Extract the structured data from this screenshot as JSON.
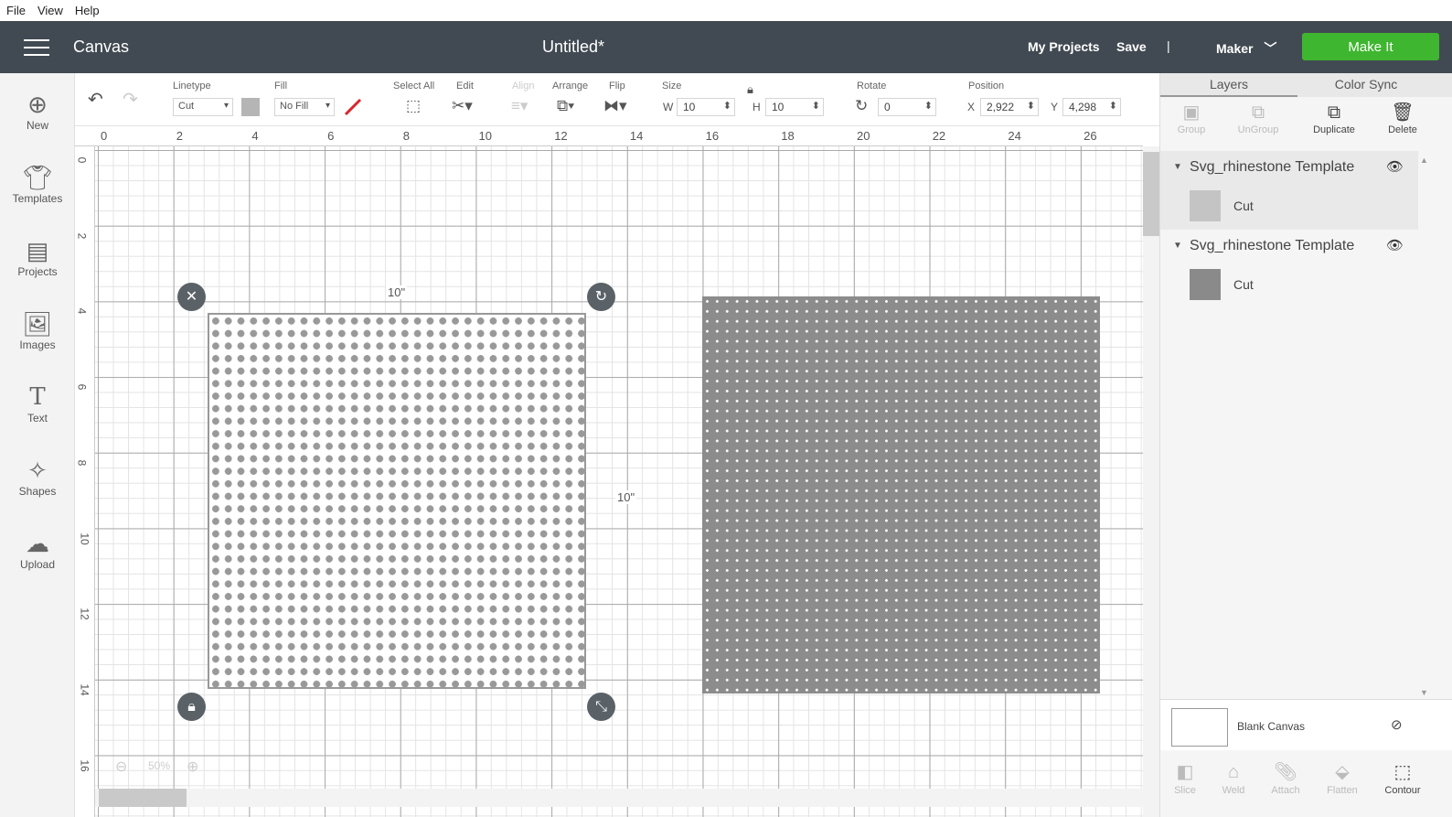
{
  "menu": [
    "File",
    "View",
    "Help"
  ],
  "header": {
    "app_title": "Canvas",
    "doc_title": "Untitled*",
    "my_projects": "My Projects",
    "save": "Save",
    "separator": "|",
    "machine": "Maker",
    "make_it": "Make It"
  },
  "toolbar": {
    "linetype_label": "Linetype",
    "linetype_value": "Cut",
    "fill_label": "Fill",
    "fill_value": "No Fill",
    "select_all_label": "Select All",
    "edit_label": "Edit",
    "align_label": "Align",
    "arrange_label": "Arrange",
    "flip_label": "Flip",
    "size_label": "Size",
    "w_label": "W",
    "w_value": "10",
    "h_label": "H",
    "h_value": "10",
    "rotate_label": "Rotate",
    "rotate_value": "0",
    "position_label": "Position",
    "x_label": "X",
    "x_value": "2,922",
    "y_label": "Y",
    "y_value": "4,298"
  },
  "sidebar": [
    {
      "label": "New",
      "icon": "plus-circle-icon"
    },
    {
      "label": "Templates",
      "icon": "tshirt-icon"
    },
    {
      "label": "Projects",
      "icon": "projects-icon"
    },
    {
      "label": "Images",
      "icon": "image-icon"
    },
    {
      "label": "Text",
      "icon": "text-icon"
    },
    {
      "label": "Shapes",
      "icon": "shapes-icon"
    },
    {
      "label": "Upload",
      "icon": "upload-cloud-icon"
    }
  ],
  "ruler": {
    "top": [
      "0",
      "2",
      "4",
      "6",
      "8",
      "10",
      "12",
      "14",
      "16",
      "18",
      "20",
      "22",
      "24",
      "26"
    ],
    "left": [
      "0",
      "2",
      "4",
      "6",
      "8",
      "10",
      "12",
      "14",
      "16"
    ]
  },
  "canvas": {
    "width_label": "10\"",
    "height_label": "10\"",
    "zoom": "50%"
  },
  "panel": {
    "tabs": [
      "Layers",
      "Color Sync"
    ],
    "tools": {
      "group": "Group",
      "ungroup": "UnGroup",
      "duplicate": "Duplicate",
      "delete": "Delete"
    },
    "layers": [
      {
        "name": "Svg_rhinestone Template",
        "item": "Cut",
        "swatch_color": "#c4c4c4"
      },
      {
        "name": "Svg_rhinestone Template",
        "item": "Cut",
        "swatch_color": "#8a8a8a"
      }
    ],
    "blank_canvas": "Blank Canvas",
    "bottom_tools": {
      "slice": "Slice",
      "weld": "Weld",
      "attach": "Attach",
      "flatten": "Flatten",
      "contour": "Contour"
    }
  },
  "colors": {
    "header_bg": "#414a52",
    "make_it": "#3fb62f",
    "accent_red": "#d9262e"
  }
}
